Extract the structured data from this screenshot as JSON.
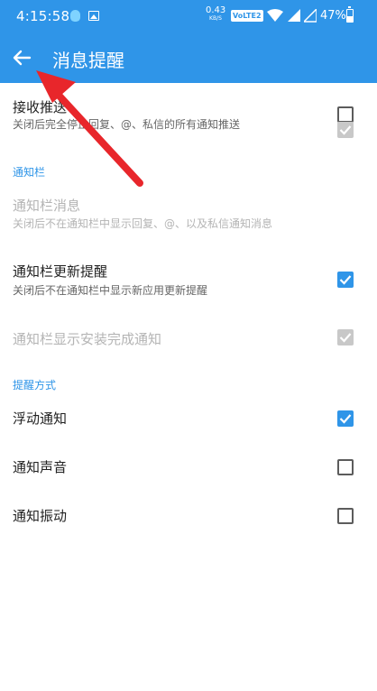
{
  "status_bar": {
    "time": "4:15:58",
    "net_speed_value": "0.43",
    "net_speed_unit": "KB/S",
    "volte": "VoLTE2",
    "battery": "47%"
  },
  "app_bar": {
    "title": "消息提醒"
  },
  "settings": {
    "push": {
      "title": "接收推送",
      "subtitle": "关闭后完全停止回复、@、私信的所有通知推送",
      "checked": false,
      "disabled": false
    },
    "notification_section": "通知栏",
    "notify_msg": {
      "title": "通知栏消息",
      "subtitle": "关闭后不在通知栏中显示回复、@、以及私信通知消息",
      "checked": true,
      "disabled": true
    },
    "notify_update": {
      "title": "通知栏更新提醒",
      "subtitle": "关闭后不在通知栏中显示新应用更新提醒",
      "checked": true,
      "disabled": false
    },
    "notify_install": {
      "title": "通知栏显示安装完成通知",
      "checked": true,
      "disabled": true
    },
    "reminder_section": "提醒方式",
    "float": {
      "title": "浮动通知",
      "checked": true,
      "disabled": false
    },
    "sound": {
      "title": "通知声音",
      "checked": false,
      "disabled": false
    },
    "vibrate": {
      "title": "通知振动",
      "checked": false,
      "disabled": false
    }
  },
  "colors": {
    "primary": "#2f95e8",
    "annotation_arrow": "#e8262b",
    "disabled_check": "#c8c8c8"
  },
  "icons": {
    "back": "arrow-left-icon",
    "annotation": "red-arrow-annotation"
  }
}
